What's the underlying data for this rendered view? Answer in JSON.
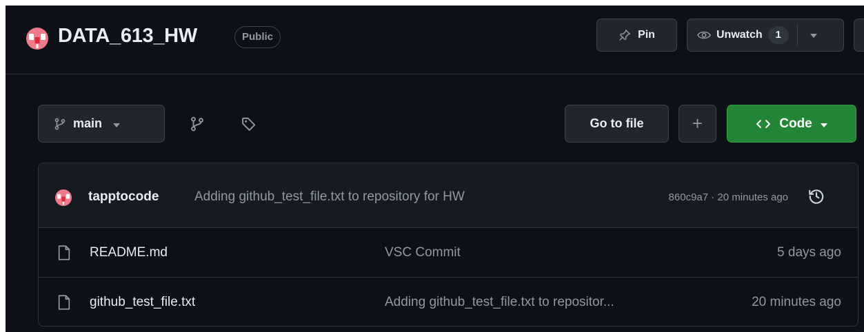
{
  "repo": {
    "name": "DATA_613_HW",
    "visibility": "Public"
  },
  "header_actions": {
    "pin_label": "Pin",
    "unwatch_label": "Unwatch",
    "watch_count": "1"
  },
  "toolbar": {
    "branch": "main",
    "go_to_file_label": "Go to file",
    "add_file_label": "+",
    "code_label": "Code"
  },
  "latest_commit": {
    "author": "tapptocode",
    "message": "Adding github_test_file.txt to repository for HW",
    "meta": "860c9a7 · 20 minutes ago"
  },
  "files": [
    {
      "name": "README.md",
      "commit": "VSC Commit",
      "date": "5 days ago"
    },
    {
      "name": "github_test_file.txt",
      "commit": "Adding github_test_file.txt to repositor...",
      "date": "20 minutes ago"
    }
  ],
  "colors": {
    "background": "#0d1117",
    "accent_green": "#238636",
    "avatar_pink": "#f07a8a",
    "avatar_red": "#e03c3c",
    "border": "#30363d"
  },
  "icons": [
    "avatar-identicon",
    "pin-icon",
    "eye-icon",
    "chevron-down-icon",
    "git-branch-icon",
    "tag-icon",
    "plus-icon",
    "code-icon",
    "history-icon",
    "file-icon"
  ]
}
